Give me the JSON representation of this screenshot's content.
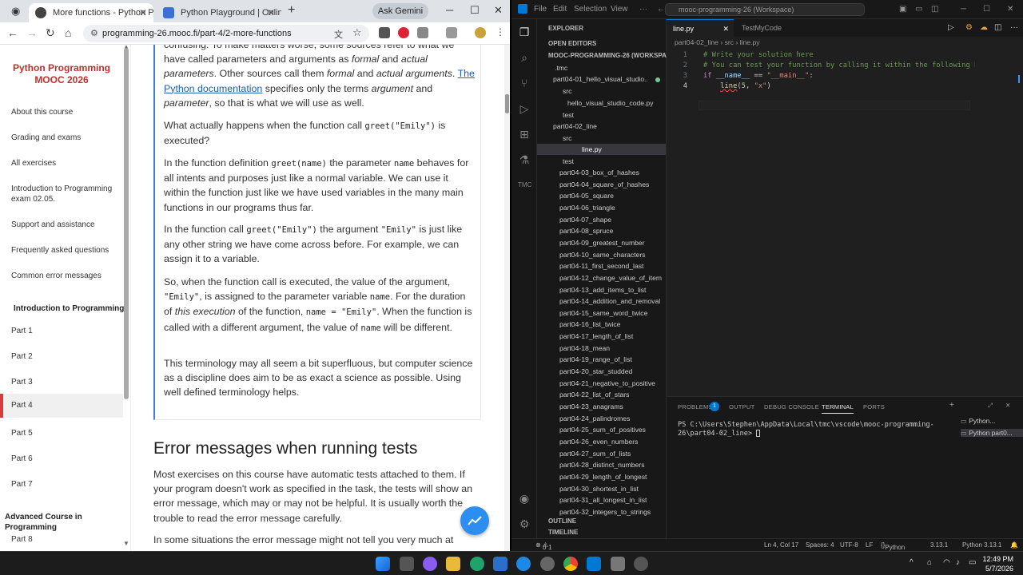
{
  "browser": {
    "tabs": [
      {
        "title": "More functions - Python Progr"
      },
      {
        "title": "Python Playground | Online IDE"
      }
    ],
    "new_tab": "+",
    "ask_gemini": "Ask Gemini",
    "url": "programming-26.mooc.fi/part-4/2-more-functions"
  },
  "sidebar": {
    "title": "Python Programming MOOC 2026",
    "items": [
      {
        "label": "About this course"
      },
      {
        "label": "Grading and exams"
      },
      {
        "label": "All exercises"
      },
      {
        "label": "Introduction to Programming exam 02.05."
      },
      {
        "label": "Support and assistance"
      },
      {
        "label": "Frequently asked questions"
      },
      {
        "label": "Common error messages"
      }
    ],
    "section1": "Introduction to Programming",
    "parts1": [
      "Part 1",
      "Part 2",
      "Part 3",
      "Part 4",
      "Part 5",
      "Part 6",
      "Part 7"
    ],
    "section2": "Advanced Course in Programming",
    "parts2": [
      "Part 8"
    ]
  },
  "article": {
    "para0_a": "confusing. To make matters worse, some sources refer to what we have called parameters and arguments as ",
    "para0_em1": "formal",
    "para0_b": " and ",
    "para0_em2": "actual parameters",
    "para0_c": ". Other sources call them ",
    "para0_em3": "formal",
    "para0_d": " and ",
    "para0_em4": "actual arguments",
    "para0_e": ". ",
    "para0_link": "The Python documentation",
    "para0_f": " specifies only the terms ",
    "para0_em5": "argument",
    "para0_g": " and ",
    "para0_em6": "parameter",
    "para0_h": ", so that is what we will use as well.",
    "para1_a": "What actually happens when the function call ",
    "para1_code": "greet(\"Emily\")",
    "para1_b": " is executed?",
    "para2_a": "In the function definition ",
    "para2_code1": "greet(name)",
    "para2_b": " the parameter ",
    "para2_code2": "name",
    "para2_c": " behaves for all intents and purposes just like a normal variable. We can use it within the function just like we have used variables in the many main functions in our programs thus far.",
    "para3_a": "In the function call ",
    "para3_code1": "greet(\"Emily\")",
    "para3_b": " the argument ",
    "para3_code2": "\"Emily\"",
    "para3_c": " is just like any other string we have come across before. For example, we can assign it to a variable.",
    "para4_a": "So, when the function call is executed, the value of the argument, ",
    "para4_code1": "\"Emily\"",
    "para4_b": ", is assigned to the parameter variable ",
    "para4_code2": "name",
    "para4_c": ". For the duration of ",
    "para4_em": "this execution",
    "para4_d": " of the function, ",
    "para4_code3": "name = \"Emily\"",
    "para4_e": ". When the function is called with a different argument, the value of ",
    "para4_code4": "name",
    "para4_f": " will be different.",
    "para5": "This terminology may all seem a bit superfluous, but computer science as a discipline does aim to be as exact a science as possible. Using well defined terminology helps.",
    "heading": "Error messages when running tests",
    "para6": "Most exercises on this course have automatic tests attached to them. If your program doesn't work as specified in the task, the tests will show an error message, which may or may not be helpful. It is usually worth the trouble to read the error message carefully.",
    "para7": "In some situations the error message might not tell you very much at"
  },
  "vscode": {
    "menu": [
      "File",
      "Edit",
      "Selection",
      "View"
    ],
    "command_center": "mooc-programming-26 (Workspace)",
    "explorer_title": "EXPLORER",
    "open_editors": "OPEN EDITORS",
    "workspace": "MOOC-PROGRAMMING-26 (WORKSPACE)",
    "tree_top": [
      ".tmc",
      "part04-01_hello_visual_studio...",
      "src",
      "hello_visual_studio_code.py",
      "test",
      "part04-02_line",
      "src",
      "line.py",
      "test"
    ],
    "tree_parts": [
      "part04-03_box_of_hashes",
      "part04-04_square_of_hashes",
      "part04-05_square",
      "part04-06_triangle",
      "part04-07_shape",
      "part04-08_spruce",
      "part04-09_greatest_number",
      "part04-10_same_characters",
      "part04-11_first_second_last",
      "part04-12_change_value_of_item",
      "part04-13_add_items_to_list",
      "part04-14_addition_and_removal",
      "part04-15_same_word_twice",
      "part04-16_list_twice",
      "part04-17_length_of_list",
      "part04-18_mean",
      "part04-19_range_of_list",
      "part04-20_star_studded",
      "part04-21_negative_to_positive",
      "part04-22_list_of_stars",
      "part04-23_anagrams",
      "part04-24_palindromes",
      "part04-25_sum_of_positives",
      "part04-26_even_numbers",
      "part04-27_sum_of_lists",
      "part04-28_distinct_numbers",
      "part04-29_length_of_longest",
      "part04-30_shortest_in_list",
      "part04-31_all_longest_in_list",
      "part04-32_integers_to_strings"
    ],
    "outline": "OUTLINE",
    "timeline": "TIMELINE",
    "editor_tabs": [
      "line.py",
      "TestMyCode"
    ],
    "breadcrumb": [
      "part04-02_line",
      "src",
      "line.py"
    ],
    "line_numbers": [
      "1",
      "2",
      "3",
      "4"
    ],
    "code": {
      "l1": "# Write your solution here",
      "l2": "# You can test your function by calling it within the following block",
      "l3_kw": "if",
      "l3_var": "__name__",
      "l3_op": " == ",
      "l3_str": "\"__main__\"",
      "l3_end": ":",
      "l4_fn": "line",
      "l4_open": "(",
      "l4_num": "5",
      "l4_sep": ", ",
      "l4_str": "\"x\"",
      "l4_close": ")"
    },
    "panel_tabs": [
      "PROBLEMS",
      "OUTPUT",
      "DEBUG CONSOLE",
      "TERMINAL",
      "PORTS"
    ],
    "problems_count": "1",
    "terminal_text": "PS C:\\Users\\Stephen\\AppData\\Local\\tmc\\vscode\\mooc-programming-26\\part04-02_line> ",
    "terminals": [
      "Python...",
      "Python part0..."
    ],
    "status": {
      "errors": "0",
      "warnings": "1",
      "position": "Ln 4, Col 17",
      "spaces": "Spaces: 4",
      "encoding": "UTF-8",
      "eol": "LF",
      "language": "Python",
      "version": "3.13.1",
      "interpreter": "Python 3.13.1"
    }
  },
  "taskbar": {
    "time": "12:49 PM",
    "date": "5/7/2026"
  },
  "colors": {
    "accent_red": "#c42e2e",
    "link_blue": "#1a5fb4",
    "vscode_blue": "#0078d4"
  }
}
